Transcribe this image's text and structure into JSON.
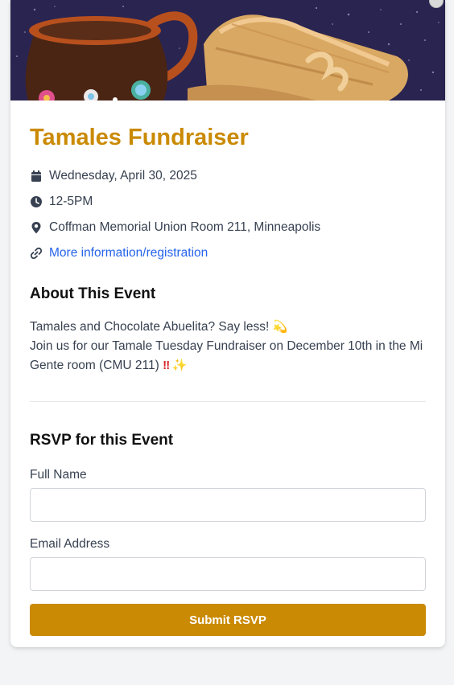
{
  "event": {
    "title": "Tamales Fundraiser",
    "date": "Wednesday, April 30, 2025",
    "time": "12-5PM",
    "location": "Coffman Memorial Union Room 211, Minneapolis",
    "link_text": "More information/registration"
  },
  "about": {
    "heading": "About This Event",
    "line1": "Tamales and Chocolate Abuelita? Say less!",
    "line2": "Join us for our Tamale Tuesday Fundraiser on December 10th in the Mi Gente room (CMU 211)",
    "emoji_swirl": "💫",
    "emoji_bang": "‼",
    "emoji_sparkle": "✨"
  },
  "rsvp": {
    "heading": "RSVP for this Event",
    "name_label": "Full Name",
    "name_value": "",
    "email_label": "Email Address",
    "email_value": "",
    "submit_label": "Submit RSVP"
  },
  "icons": {
    "date": "calendar-icon",
    "time": "clock-icon",
    "location": "map-pin-icon",
    "link": "link-icon"
  },
  "colors": {
    "accent": "#ca8a04",
    "link": "#2563eb",
    "hero_bg": "#2a2450"
  }
}
